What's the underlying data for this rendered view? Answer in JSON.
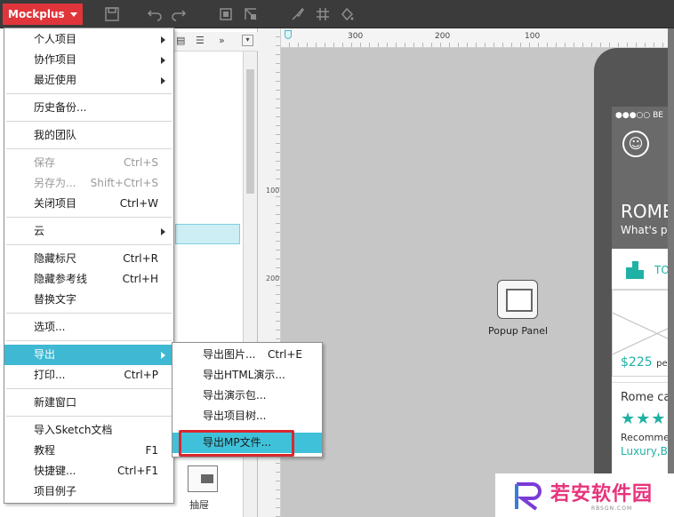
{
  "app": {
    "brand": "Mockplus"
  },
  "panel": {
    "drawer_label": "抽屉"
  },
  "menu": {
    "items": [
      {
        "label": "个人项目",
        "submenu": true
      },
      {
        "label": "协作项目",
        "submenu": true
      },
      {
        "label": "最近使用",
        "submenu": true
      },
      {
        "label": "历史备份..."
      },
      {
        "label": "我的团队"
      },
      {
        "label": "保存",
        "shortcut": "Ctrl+S",
        "disabled": true
      },
      {
        "label": "另存为...",
        "shortcut": "Shift+Ctrl+S",
        "disabled": true
      },
      {
        "label": "关闭项目",
        "shortcut": "Ctrl+W"
      },
      {
        "label": "云",
        "submenu": true
      },
      {
        "label": "隐藏标尺",
        "shortcut": "Ctrl+R"
      },
      {
        "label": "隐藏参考线",
        "shortcut": "Ctrl+H"
      },
      {
        "label": "替换文字"
      },
      {
        "label": "选项..."
      },
      {
        "label": "导出",
        "submenu": true,
        "active": true
      },
      {
        "label": "打印...",
        "shortcut": "Ctrl+P"
      },
      {
        "label": "新建窗口"
      },
      {
        "label": "导入Sketch文档"
      },
      {
        "label": "教程",
        "shortcut": "F1"
      },
      {
        "label": "快捷键...",
        "shortcut": "Ctrl+F1"
      },
      {
        "label": "项目例子"
      }
    ]
  },
  "export_submenu": {
    "items": [
      {
        "label": "导出图片...",
        "shortcut": "Ctrl+E"
      },
      {
        "label": "导出HTML演示..."
      },
      {
        "label": "导出演示包..."
      },
      {
        "label": "导出项目树..."
      },
      {
        "label": "导出MP文件...",
        "highlighted": true
      }
    ]
  },
  "ruler": {
    "horizontal_labels": [
      "300",
      "200",
      "100"
    ],
    "vertical_labels": [
      "100",
      "200"
    ]
  },
  "canvas": {
    "popup_label": "Popup Panel",
    "phone": {
      "status": "●●●○○ BE",
      "city": "ROME",
      "subtitle": "What's p",
      "tab_label": "TO",
      "price": "$225",
      "price_suffix": "pe",
      "card_title": "Rome ca",
      "stars": "★★★",
      "recommend": "Recomme",
      "tags": "Luxury,B"
    }
  },
  "watermark": {
    "text": "若安软件园",
    "sub": "RBSGN.COM"
  },
  "colors": {
    "brand": "#e0353b",
    "menu_active": "#3fb8d3",
    "accent": "#1fb1a4",
    "highlight_box": "#d9282f"
  }
}
